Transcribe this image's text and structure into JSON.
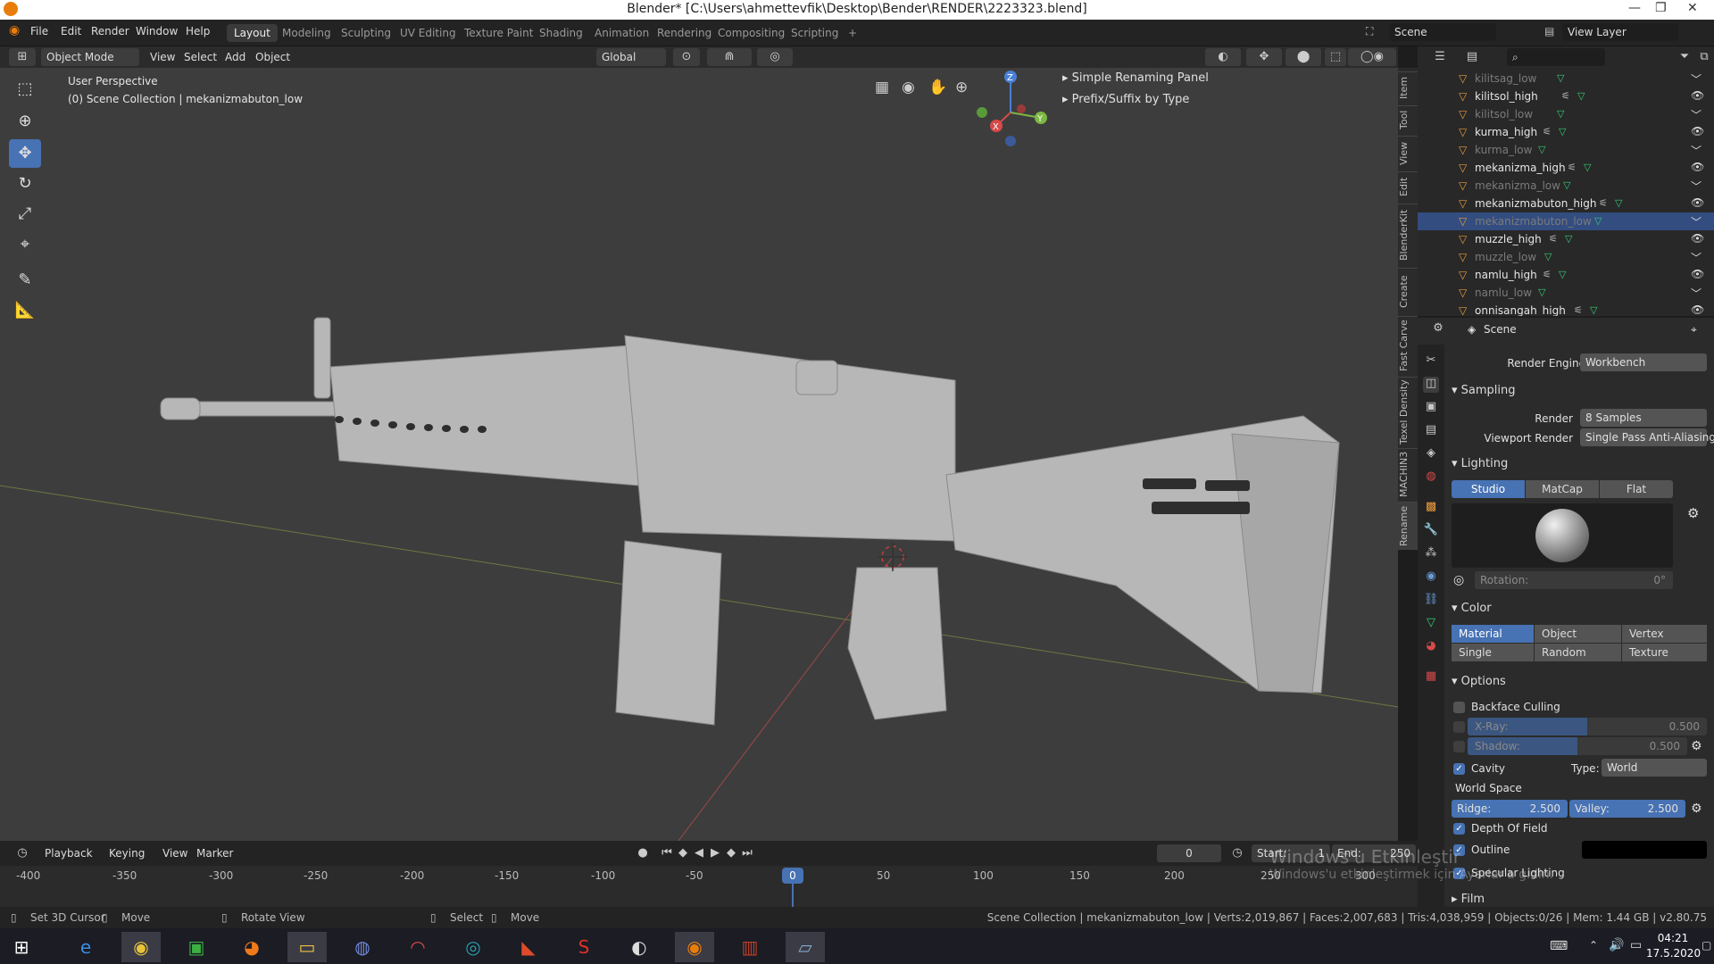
{
  "window": {
    "title": "Blender* [C:\\Users\\ahmettevfik\\Desktop\\Bender\\RENDER\\2223323.blend]"
  },
  "menu": {
    "file": "File",
    "edit": "Edit",
    "render": "Render",
    "window": "Window",
    "help": "Help"
  },
  "workspaces": [
    "Layout",
    "Modeling",
    "Sculpting",
    "UV Editing",
    "Texture Paint",
    "Shading",
    "Animation",
    "Rendering",
    "Compositing",
    "Scripting",
    "+"
  ],
  "topright": {
    "scene": "Scene",
    "view_layer": "View Layer"
  },
  "header": {
    "mode": "Object Mode",
    "view": "View",
    "select": "Select",
    "add": "Add",
    "object": "Object",
    "orientation": "Global"
  },
  "viewport": {
    "perspective": "User Perspective",
    "collection": "(0) Scene Collection | mekanizmabuton_low",
    "panel_renaming": "Simple Renaming Panel",
    "panel_prefix": "Prefix/Suffix by Type"
  },
  "gizmo": {
    "z": "Z",
    "y": "Y",
    "x": "X"
  },
  "sidebar_tabs": [
    "Item",
    "Tool",
    "View",
    "Edit",
    "BlenderKit",
    "Create",
    "Fast Carve",
    "Texel Density",
    "MACHIN3",
    "Rename"
  ],
  "outliner": {
    "rows": [
      {
        "name": "kilitsag_low",
        "dim": true,
        "sel": false,
        "eye": false
      },
      {
        "name": "kilitsol_high",
        "dim": false,
        "sel": false,
        "eye": true
      },
      {
        "name": "kilitsol_low",
        "dim": true,
        "sel": false,
        "eye": false
      },
      {
        "name": "kurma_high",
        "dim": false,
        "sel": false,
        "eye": true
      },
      {
        "name": "kurma_low",
        "dim": true,
        "sel": false,
        "eye": false
      },
      {
        "name": "mekanizma_high",
        "dim": false,
        "sel": false,
        "eye": true
      },
      {
        "name": "mekanizma_low",
        "dim": true,
        "sel": false,
        "eye": false
      },
      {
        "name": "mekanizmabuton_high",
        "dim": false,
        "sel": false,
        "eye": true
      },
      {
        "name": "mekanizmabuton_low",
        "dim": true,
        "sel": true,
        "eye": false
      },
      {
        "name": "muzzle_high",
        "dim": false,
        "sel": false,
        "eye": true
      },
      {
        "name": "muzzle_low",
        "dim": true,
        "sel": false,
        "eye": false
      },
      {
        "name": "namlu_high",
        "dim": false,
        "sel": false,
        "eye": true
      },
      {
        "name": "namlu_low",
        "dim": true,
        "sel": false,
        "eye": false
      },
      {
        "name": "onnisangah_high",
        "dim": false,
        "sel": false,
        "eye": true
      }
    ]
  },
  "properties": {
    "context": "Scene",
    "render_engine_label": "Render Engine",
    "render_engine": "Workbench",
    "sampling": "Sampling",
    "render_label": "Render",
    "render_samples": "8 Samples",
    "viewport_render_label": "Viewport Render",
    "viewport_render": "Single Pass Anti-Aliasing",
    "lighting": "Lighting",
    "lighting_modes": [
      "Studio",
      "MatCap",
      "Flat"
    ],
    "rotation_label": "Rotation:",
    "rotation_value": "0°",
    "color": "Color",
    "color_modes": [
      "Material",
      "Object",
      "Vertex",
      "Single",
      "Random",
      "Texture"
    ],
    "options": "Options",
    "backface": "Backface Culling",
    "xray_label": "X-Ray:",
    "xray_value": "0.500",
    "xray_fraction": 0.5,
    "shadow_label": "Shadow:",
    "shadow_value": "0.500",
    "shadow_fraction": 0.5,
    "cavity": "Cavity",
    "type_label": "Type:",
    "type_value": "World",
    "world_space": "World Space",
    "ridge_label": "Ridge:",
    "ridge_value": "2.500",
    "valley_label": "Valley:",
    "valley_value": "2.500",
    "dof": "Depth Of Field",
    "outline": "Outline",
    "outline_color": "#000000",
    "specular": "Specular Lighting",
    "film": "Film"
  },
  "timeline": {
    "playback": "Playback",
    "keying": "Keying",
    "view": "View",
    "marker": "Marker",
    "current_frame": "0",
    "start_label": "Start:",
    "start_value": "1",
    "end_label": "End:",
    "end_value": "250",
    "ticks": [
      "-400",
      "-350",
      "-300",
      "-250",
      "-200",
      "-150",
      "-100",
      "-50",
      "0",
      "50",
      "100",
      "150",
      "200",
      "250",
      "300"
    ]
  },
  "activation": {
    "line1": "Windows'u Etkinleştir",
    "line2": "Windows'u etkinleştirmek için Ayarlar'a gidin."
  },
  "status": {
    "set_cursor": "Set 3D Cursor",
    "move": "Move",
    "rotate_view": "Rotate View",
    "select": "Select",
    "move2": "Move",
    "info": "Scene Collection | mekanizmabuton_low | Verts:2,019,867 | Faces:2,007,683 | Tris:4,038,959 | Objects:0/26 | Mem: 1.44 GB | v2.80.75"
  },
  "clock": {
    "time": "04:21",
    "date": "17.5.2020"
  },
  "colors": {
    "accent": "#4772b3",
    "viewport_bg": "#3d3d3d",
    "model": "#b7b7b7"
  }
}
